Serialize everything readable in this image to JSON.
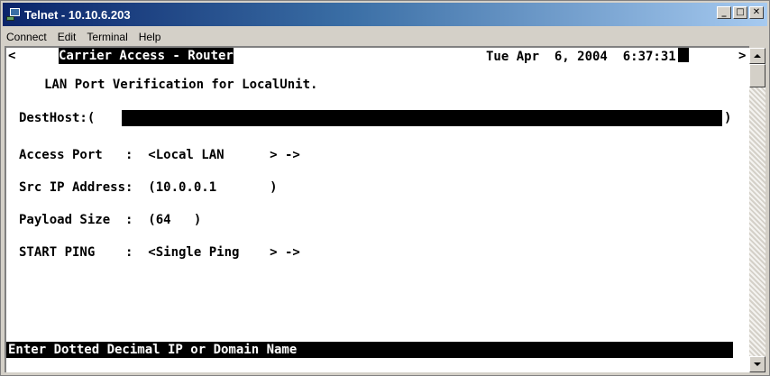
{
  "window": {
    "title": "Telnet - 10.10.6.203",
    "buttons": {
      "minimize": "_",
      "maximize": "□",
      "close": "✕"
    }
  },
  "menu": {
    "items": [
      "Connect",
      "Edit",
      "Terminal",
      "Help"
    ]
  },
  "terminal": {
    "left_arrow": "<",
    "header_title": "Carrier Access - Router",
    "datetime": "Tue Apr  6, 2004  6:37:31",
    "right_arrow": ">",
    "subtitle": "LAN Port Verification for LocalUnit.",
    "dest_host_label": "DestHost:(",
    "dest_host_close": ")",
    "access_port_line": "Access Port   :  <Local LAN      > ->",
    "src_ip_line": "Src IP Address:  (10.0.0.1       )",
    "payload_line": "Payload Size  :  (64   )",
    "start_ping_line": "START PING    :  <Single Ping    > ->",
    "status_message": "Enter Dotted Decimal IP or Domain Name"
  },
  "colors": {
    "titlebar_start": "#0a246a",
    "titlebar_end": "#a6caf0",
    "terminal_bg": "#ffffff",
    "terminal_fg": "#000000"
  }
}
